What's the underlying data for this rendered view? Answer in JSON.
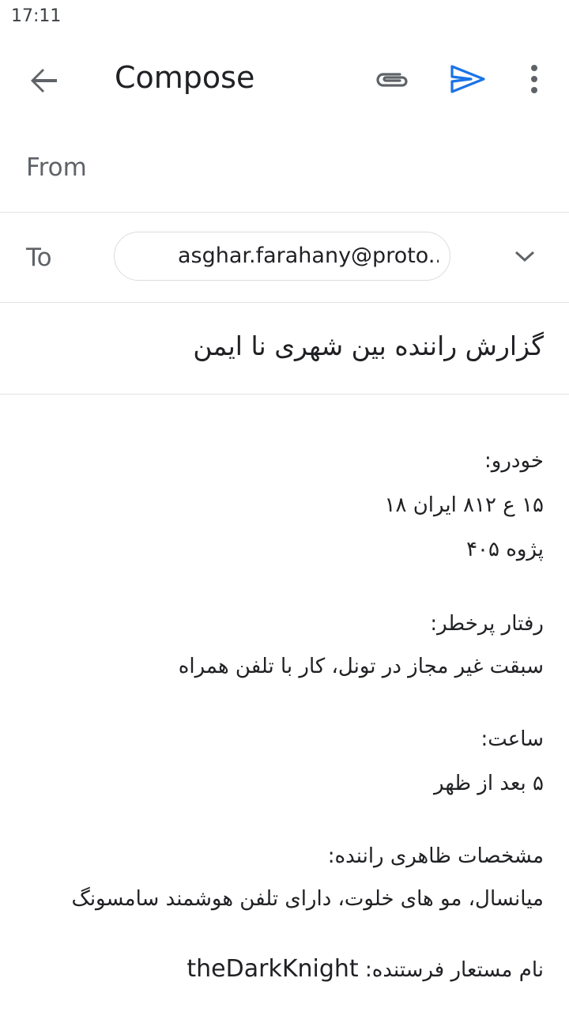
{
  "status_bar": {
    "time": "17:11"
  },
  "app_bar": {
    "title": "Compose"
  },
  "from": {
    "label": "From",
    "value": ""
  },
  "to": {
    "label": "To",
    "recipient": "asghar.farahany@proto..."
  },
  "subject": "گزارش راننده بین شهری نا ایمن",
  "body": {
    "vehicle_label": "خودرو:",
    "vehicle_plate": "۱۵ ع ۸۱۲ ایران ۱۸",
    "vehicle_model": "پژوه ۴۰۵",
    "behavior_label": "رفتار پرخطر:",
    "behavior_value": "سبقت غیر مجاز در تونل، کار با تلفن همراه",
    "time_label": "ساعت:",
    "time_value": "۵ بعد از ظهر",
    "appearance_label": "مشخصات ظاهری راننده:",
    "appearance_value": "میانسال، مو های خلوت، دارای تلفن هوشمند سامسونگ",
    "sender_label": "نام مستعار فرستنده:",
    "sender_value": "theDarkKnight"
  },
  "icons": {
    "back": "arrow-back-icon",
    "attach": "paperclip-icon",
    "send": "send-icon",
    "more": "more-vert-icon",
    "expand": "chevron-down-icon"
  },
  "colors": {
    "send_accent": "#1a73e8",
    "icon_gray": "#5f6368"
  }
}
